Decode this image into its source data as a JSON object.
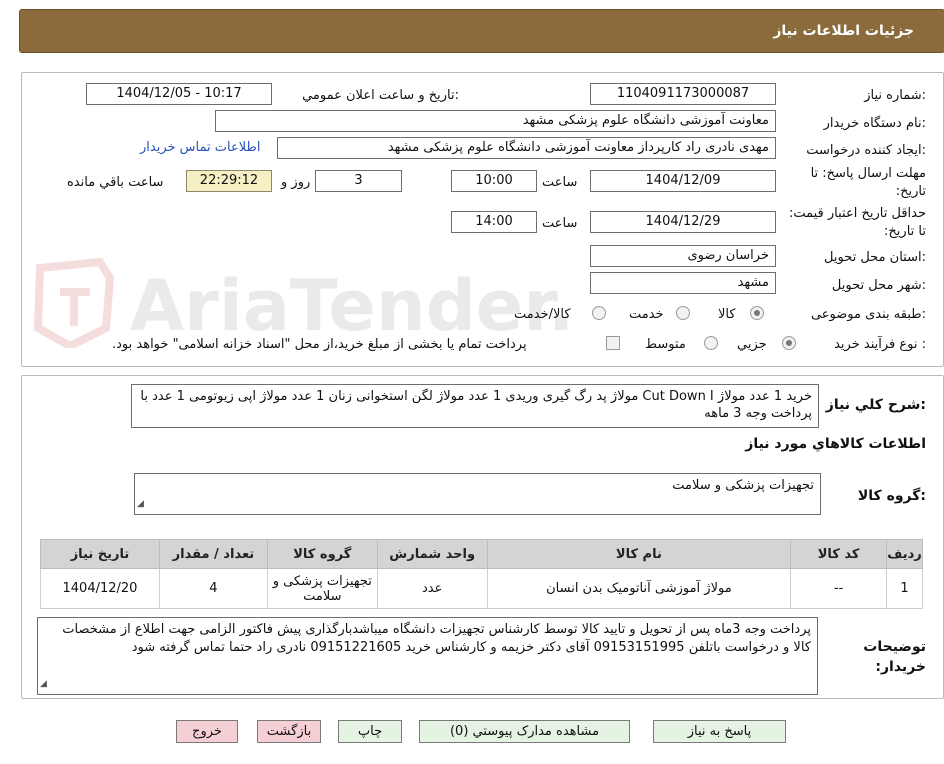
{
  "header": {
    "title": "جزئیات اطلاعات نیاز"
  },
  "form": {
    "need_number_label": "شماره نیاز:",
    "need_number": "1104091173000087",
    "announce_label": "تاریخ و ساعت اعلان عمومي:",
    "announce_value": "1404/12/05 - 10:17",
    "buyer_org_label": "نام دستگاه خریدار:",
    "buyer_org": "معاونت آموزشی دانشگاه علوم پزشکی مشهد",
    "requester_label": "ایجاد کننده درخواست:",
    "requester": "مهدی نادری راد کارپرداز معاونت آموزشی دانشگاه علوم پزشکی مشهد",
    "contact_link": "اطلاعات تماس خریدار",
    "deadline_label": "مهلت ارسال پاسخ: تا تاریخ:",
    "deadline_date": "1404/12/09",
    "time_label": "ساعت",
    "deadline_time": "10:00",
    "days_value": "3",
    "days_label": "روز و",
    "remaining_time": "22:29:12",
    "remaining_label": "ساعت باقي مانده",
    "validity_label": "حداقل تاریخ اعتبار قیمت: تا تاریخ:",
    "validity_date": "1404/12/29",
    "validity_time": "14:00",
    "province_label": "استان محل تحویل:",
    "province": "خراسان رضوی",
    "city_label": "شهر محل تحویل:",
    "city": "مشهد",
    "category_label": "طبقه بندی موضوعی:",
    "category_options": [
      "کالا",
      "خدمت",
      "کالا/خدمت"
    ],
    "process_label": "نوع فرآیند خرید :",
    "process_options": [
      "جزیي",
      "متوسط"
    ],
    "payment_note": "پرداخت تمام یا بخشی از مبلغ خرید،از محل \"اسناد خزانه اسلامی\" خواهد بود."
  },
  "summary": {
    "label": "شرح کلي نیاز:",
    "text": "خرید 1 عدد مولاژ Cut Down I مولاژ پد رگ گیری وریدی 1 عدد مولاژ لگن استخوانی زنان 1 عدد مولاژ اپی زیوتومی 1 عدد با پرداخت وجه 3 ماهه"
  },
  "goods": {
    "section_title": "اطلاعات کالاهاي مورد نیاز",
    "group_label": "گروه کالا:",
    "group_value": "تجهیزات پزشکی و سلامت",
    "columns": [
      "ردیف",
      "کد کالا",
      "نام کالا",
      "واحد شمارش",
      "گروه کالا",
      "تعداد / مقدار",
      "تاریخ نیاز"
    ],
    "rows": [
      [
        "1",
        "--",
        "مولاژ آموزشی آناتومیک بدن انسان",
        "عدد",
        "تجهیزات پزشکی و سلامت",
        "4",
        "1404/12/20"
      ]
    ]
  },
  "buyer_notes": {
    "label": "توضیحات خریدار:",
    "text": "پرداخت وجه 3ماه پس از تحویل و تایید کالا توسط کارشناس تجهیزات دانشگاه میباشدبارگذاری پیش فاکتور الزامی جهت اطلاع از مشخصات کالا و درخواست باتلفن 09153151995 آقای دکتر خزیمه و کارشناس خرید 09151221605 نادری راد حتما تماس گرفته شود"
  },
  "buttons": {
    "reply": "پاسخ به نیاز",
    "attachments": "مشاهده مدارک پیوستي (0)",
    "print": "چاپ",
    "back": "بازگشت",
    "exit": "خروج"
  },
  "colors": {
    "title_bar": "#8b6a3c",
    "timer_bg": "#f5f0c4",
    "link": "#2a52b8",
    "header_cell": "#d4d4d4",
    "btn_green": "#e5f3e3",
    "btn_pink": "#f6cfd4"
  }
}
